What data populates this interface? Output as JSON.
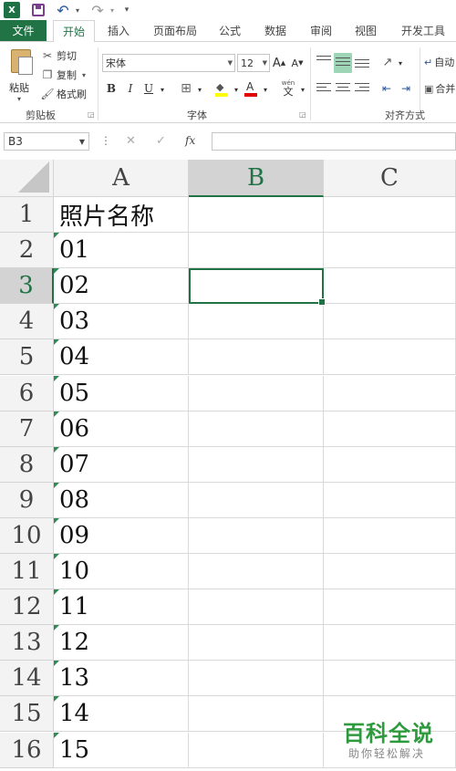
{
  "app": {
    "logo_text": "X"
  },
  "tabs": {
    "file": "文件",
    "items": [
      "开始",
      "插入",
      "页面布局",
      "公式",
      "数据",
      "审阅",
      "视图",
      "开发工具"
    ],
    "active": "开始"
  },
  "ribbon": {
    "clipboard": {
      "paste": "粘贴",
      "cut": "剪切",
      "copy": "复制",
      "format_painter": "格式刷",
      "group_label": "剪贴板"
    },
    "font": {
      "font_name": "宋体",
      "font_size": "12",
      "grow_label": "A",
      "shrink_label": "A",
      "bold": "B",
      "italic": "I",
      "underline": "U",
      "phonetic": "wén",
      "phonetic_char": "文",
      "font_color_label": "A",
      "group_label": "字体"
    },
    "alignment": {
      "group_label": "对齐方式",
      "wrap_label": "自动",
      "merge_label": "合并"
    }
  },
  "formula_bar": {
    "name_box": "B3",
    "fx": "fx",
    "formula": ""
  },
  "sheet": {
    "columns": [
      "A",
      "B",
      "C"
    ],
    "active_column": "B",
    "rows": [
      {
        "num": "1",
        "a": "照片名称",
        "flag": false
      },
      {
        "num": "2",
        "a": "01",
        "flag": true
      },
      {
        "num": "3",
        "a": "02",
        "flag": true
      },
      {
        "num": "4",
        "a": "03",
        "flag": true
      },
      {
        "num": "5",
        "a": "04",
        "flag": true
      },
      {
        "num": "6",
        "a": "05",
        "flag": true
      },
      {
        "num": "7",
        "a": "06",
        "flag": true
      },
      {
        "num": "8",
        "a": "07",
        "flag": true
      },
      {
        "num": "9",
        "a": "08",
        "flag": true
      },
      {
        "num": "10",
        "a": "09",
        "flag": true
      },
      {
        "num": "11",
        "a": "10",
        "flag": true
      },
      {
        "num": "12",
        "a": "11",
        "flag": true
      },
      {
        "num": "13",
        "a": "12",
        "flag": true
      },
      {
        "num": "14",
        "a": "13",
        "flag": true
      },
      {
        "num": "15",
        "a": "14",
        "flag": true
      },
      {
        "num": "16",
        "a": "15",
        "flag": true
      }
    ],
    "active_row": "3",
    "selected_cell": "B3"
  },
  "watermark": {
    "title": "百科全说",
    "subtitle": "助你轻松解决"
  },
  "colors": {
    "accent": "#217346",
    "text_flag": "#2e8b57",
    "watermark": "#2e9a3e"
  }
}
